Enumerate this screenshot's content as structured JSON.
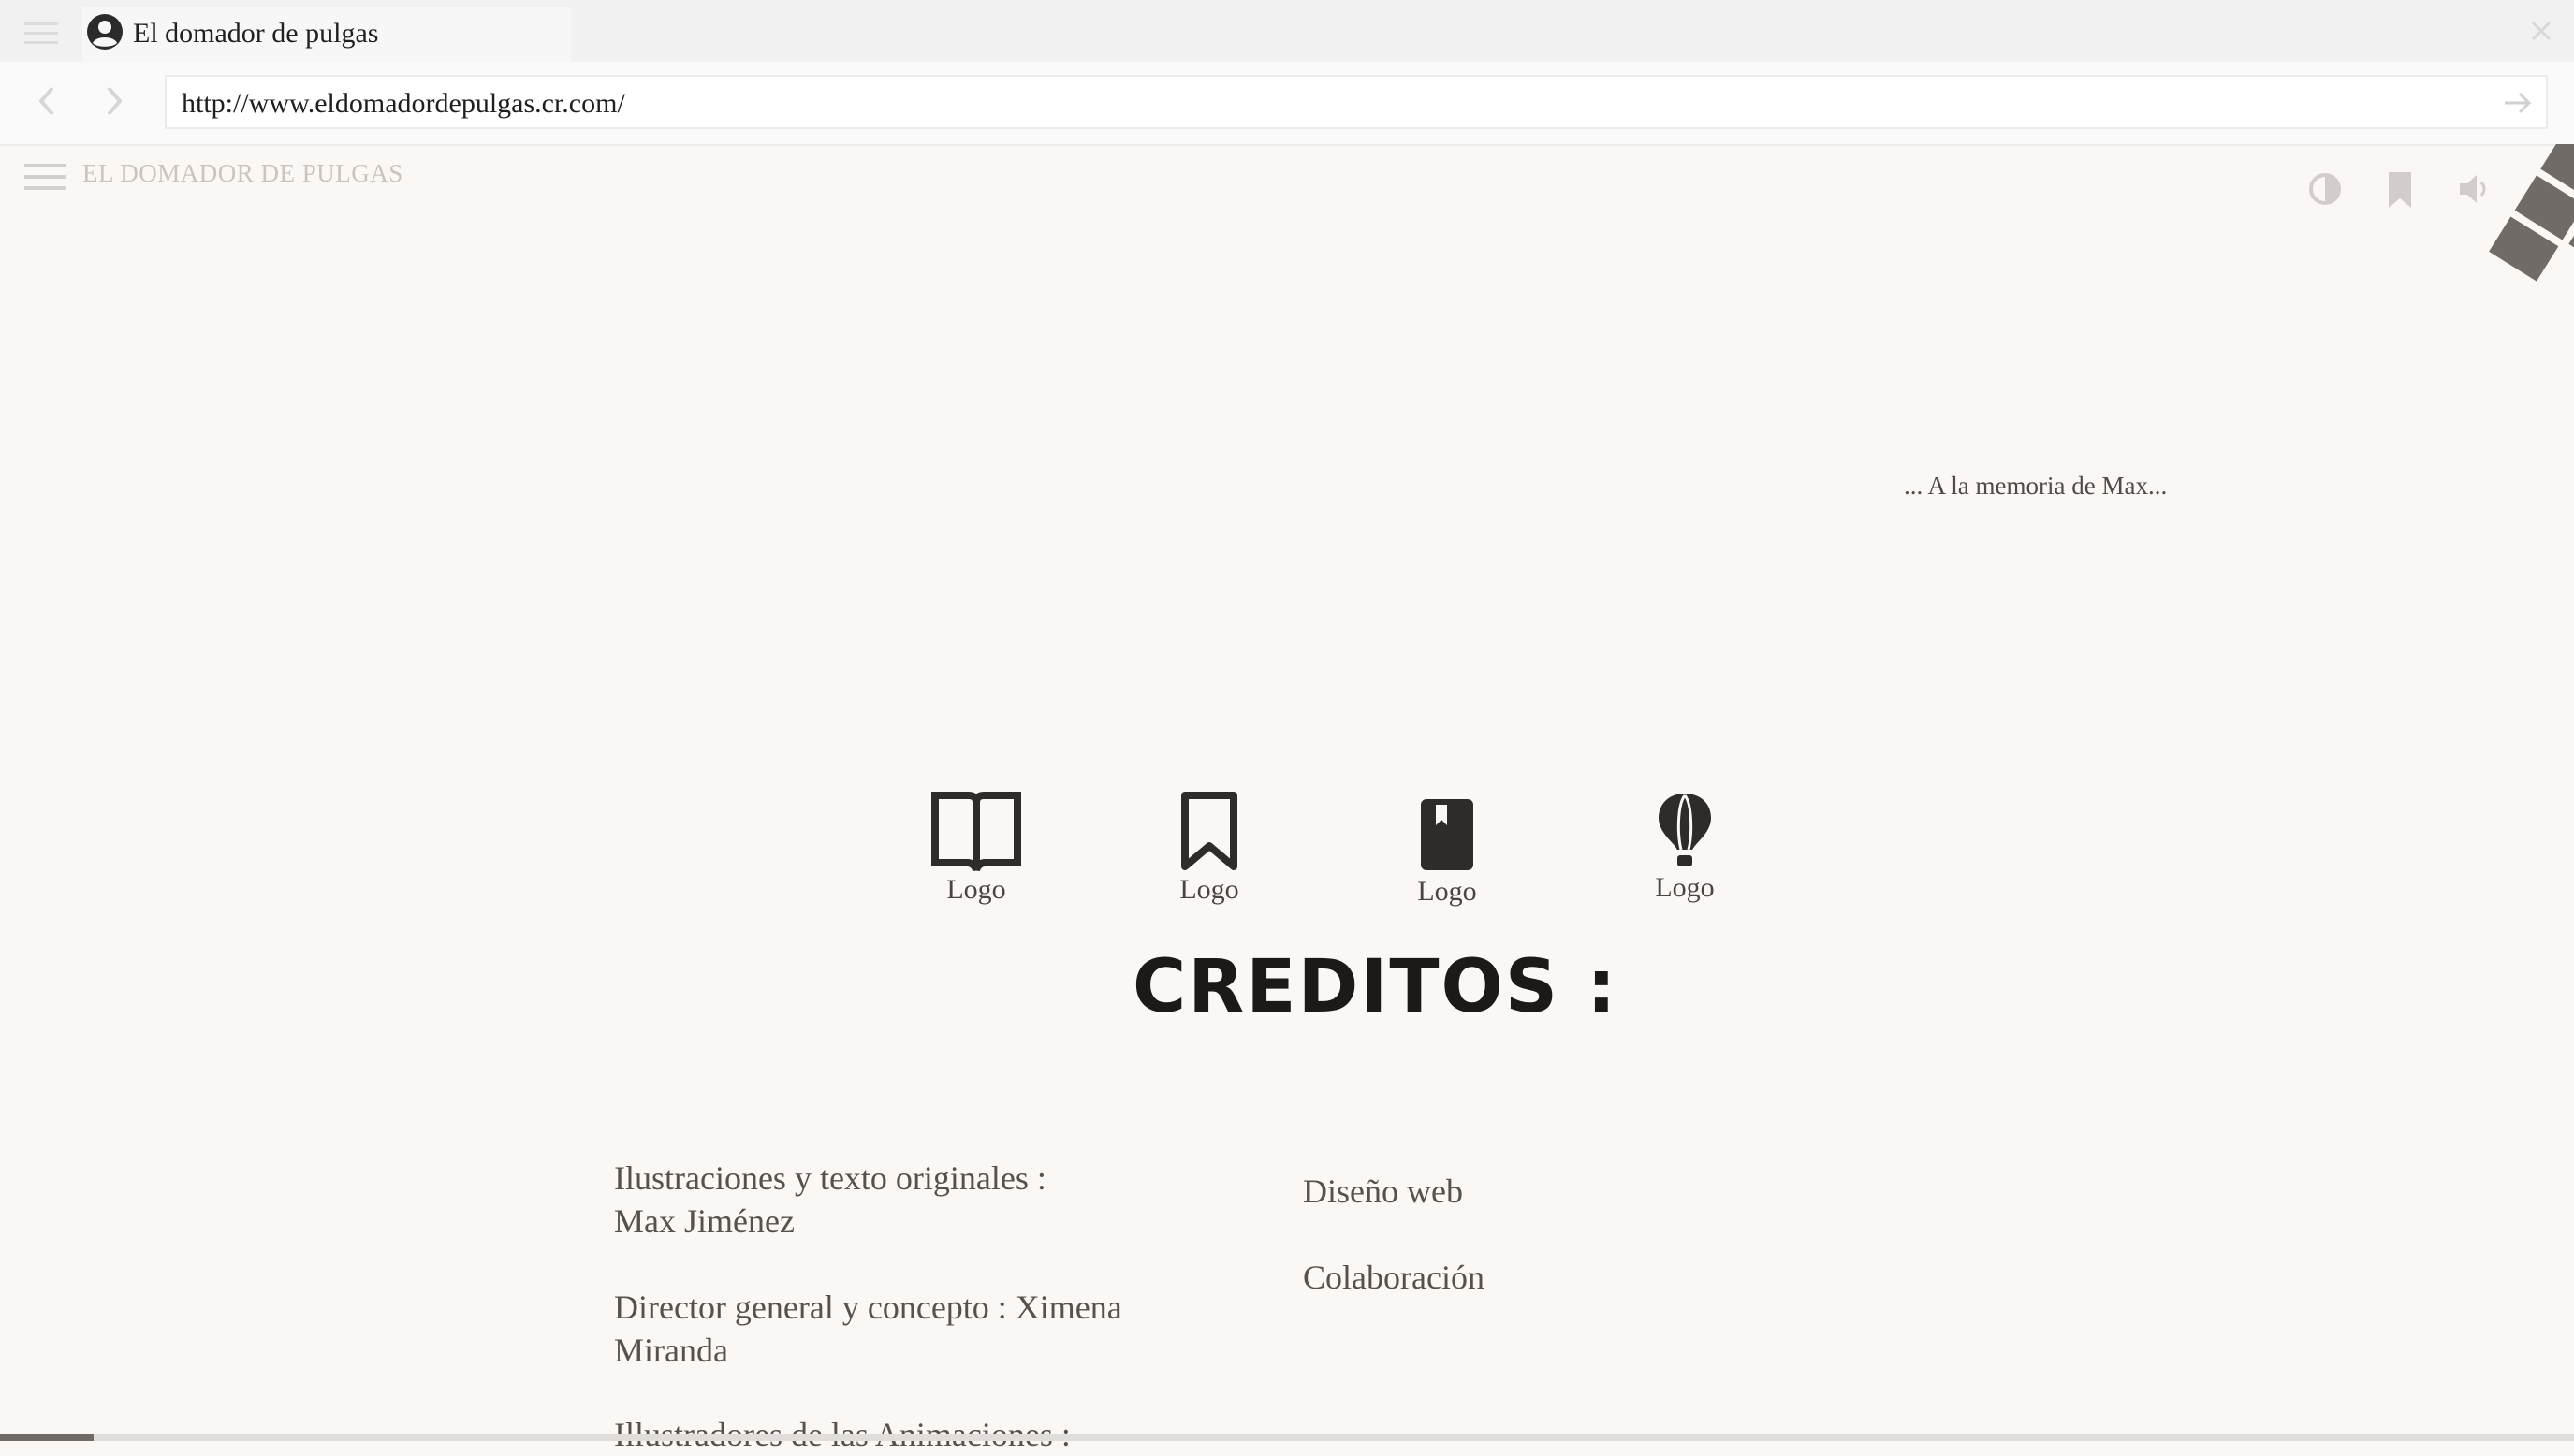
{
  "browser": {
    "tab_title": "El domador de pulgas",
    "url": "http://www.eldomadordepulgas.cr.com/",
    "icons": {
      "menu": "hamburger-menu-icon",
      "avatar": "account-circle-icon",
      "close": "close-icon",
      "back": "chevron-left-icon",
      "forward": "chevron-right-icon",
      "go": "arrow-right-icon"
    }
  },
  "site": {
    "title": "EL DOMADOR DE PULGAS",
    "toolbar_icons": [
      "contrast-icon",
      "bookmark-icon",
      "volume-icon"
    ],
    "dedication": "... A la memoria de Max...",
    "logos": [
      {
        "label": "Logo",
        "icon": "open-book-icon"
      },
      {
        "label": "Logo",
        "icon": "bookmark-icon"
      },
      {
        "label": "Logo",
        "icon": "closed-book-icon"
      },
      {
        "label": "Logo",
        "icon": "hot-air-balloon-icon"
      }
    ],
    "credits_heading": "CREDITOS :",
    "credits_left": [
      "Ilustraciones y texto originales :",
      "Max Jiménez",
      "Director general y concepto : Ximena",
      "Miranda",
      "Illustradores de las Animaciones :"
    ],
    "credits_right": [
      "Diseño web",
      "Colaboración"
    ]
  },
  "colors": {
    "page_background": "#faf7f4",
    "text": "#3b3735",
    "muted_title": "#c9c4c0",
    "icon_dark": "#2f2b2a"
  }
}
